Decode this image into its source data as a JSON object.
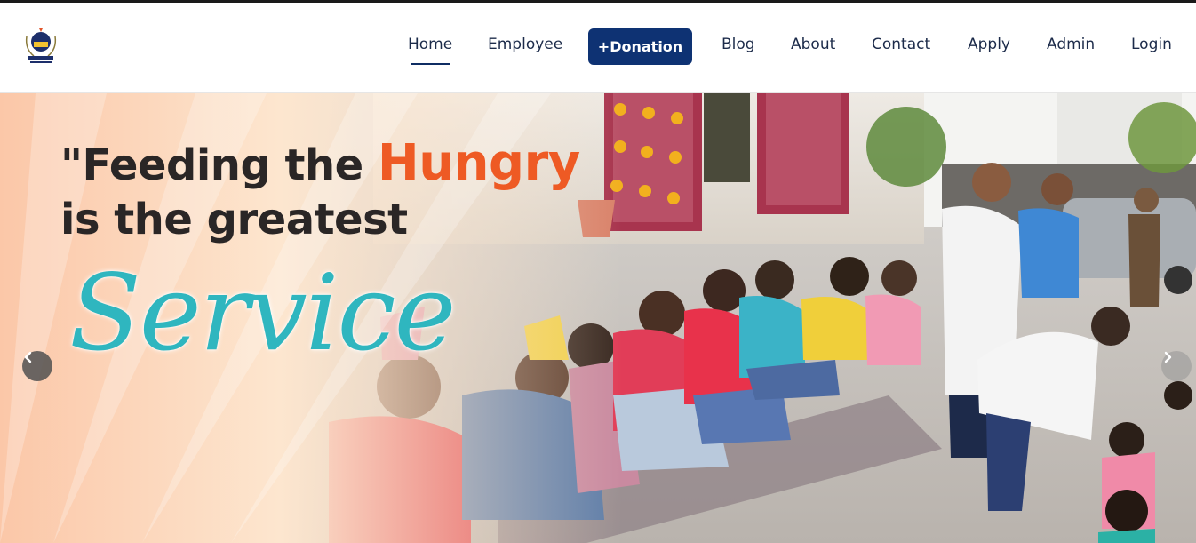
{
  "nav": {
    "logo_icon": "foundation-crest-logo",
    "items": [
      {
        "label": "Home",
        "active": true
      },
      {
        "label": "Employee"
      },
      {
        "label": "Blog"
      },
      {
        "label": "About"
      },
      {
        "label": "Contact"
      },
      {
        "label": "Apply"
      },
      {
        "label": "Admin"
      },
      {
        "label": "Login"
      }
    ],
    "donate_label": "+Donation",
    "accent_color": "#0e3273"
  },
  "hero": {
    "headline_line1_prefix": "\"Feeding the ",
    "headline_highlight": "Hungry",
    "headline_line2": "is the greatest",
    "script_word": "Service",
    "highlight_color": "#ee5a24",
    "script_color": "#2fb6bf",
    "prev_icon": "chevron-left-icon",
    "next_icon": "chevron-right-icon"
  }
}
